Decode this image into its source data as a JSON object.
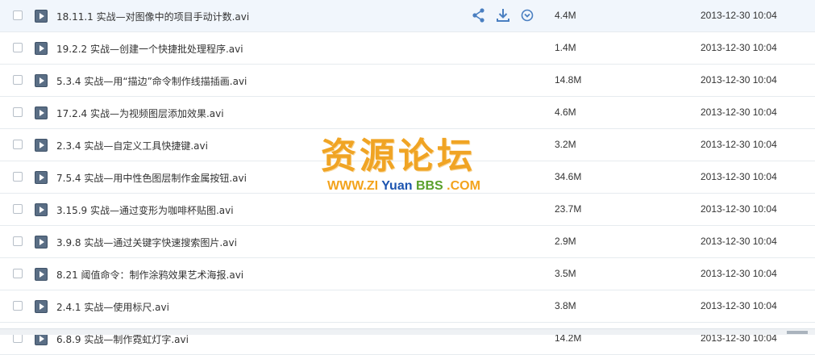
{
  "files": [
    {
      "name": "18.11.1 实战—对图像中的项目手动计数.avi",
      "size": "4.4M",
      "date": "2013-12-30 10:04"
    },
    {
      "name": "19.2.2 实战—创建一个快捷批处理程序.avi",
      "size": "1.4M",
      "date": "2013-12-30 10:04"
    },
    {
      "name": "5.3.4 实战—用“描边”命令制作线描插画.avi",
      "size": "14.8M",
      "date": "2013-12-30 10:04"
    },
    {
      "name": "17.2.4 实战—为视频图层添加效果.avi",
      "size": "4.6M",
      "date": "2013-12-30 10:04"
    },
    {
      "name": "2.3.4 实战—自定义工具快捷键.avi",
      "size": "3.2M",
      "date": "2013-12-30 10:04"
    },
    {
      "name": "7.5.4 实战—用中性色图层制作金属按钮.avi",
      "size": "34.6M",
      "date": "2013-12-30 10:04"
    },
    {
      "name": "3.15.9 实战—通过变形为咖啡杯贴图.avi",
      "size": "23.7M",
      "date": "2013-12-30 10:04"
    },
    {
      "name": "3.9.8 实战—通过关键字快速搜索图片.avi",
      "size": "2.9M",
      "date": "2013-12-30 10:04"
    },
    {
      "name": "8.21 阈值命令：制作涂鸦效果艺术海报.avi",
      "size": "3.5M",
      "date": "2013-12-30 10:04"
    },
    {
      "name": "2.4.1 实战—使用标尺.avi",
      "size": "3.8M",
      "date": "2013-12-30 10:04"
    },
    {
      "name": "6.8.9 实战—制作霓虹灯字.avi",
      "size": "14.2M",
      "date": "2013-12-30 10:04"
    }
  ],
  "row_actions": {
    "share_icon": "share-icon",
    "download_icon": "download-icon",
    "more_icon": "chevron-down-circle-icon"
  },
  "watermark": {
    "title": "资源论坛",
    "url_part1": "WWW.",
    "url_part2": "ZI",
    "url_part3": "Yuan",
    "url_part4": "BBS",
    "url_part5": ".COM"
  },
  "colors": {
    "icon_blue": "#4a7fc1",
    "row_hover": "#f1f6fc",
    "watermark_orange": "#f0a424",
    "watermark_blue": "#1d55b0",
    "watermark_green": "#5aa02c"
  }
}
